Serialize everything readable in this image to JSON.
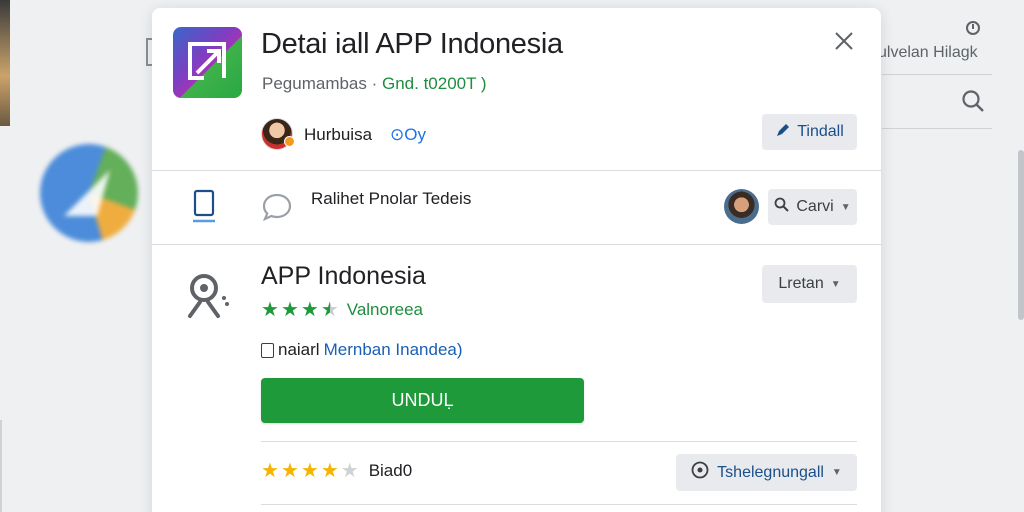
{
  "background": {
    "right_label": "ulvelan Hilagk"
  },
  "dialog": {
    "title": "Detai iall APP Indonesia",
    "subtitle_prefix": "Pegumambas · ",
    "subtitle_status": "Gnd. t0200T )",
    "developer": {
      "name": "Hurbuisa",
      "badge": "Oy"
    },
    "primary_action": "Tindall",
    "row2": {
      "text": "Ralihet Pnolar Tedeis",
      "search_button": "Carvi"
    },
    "app": {
      "name": "APP Indonesia",
      "rating_stars": 3.5,
      "rating_label": "Valnoreea",
      "filter_button": "Lretan",
      "checkbox_label": "naiarl",
      "link_text": "Mernban Inandea)",
      "install_label": "UNDUḶ"
    },
    "review": {
      "rating_stars": 4,
      "rating_label": "Biad0",
      "sort_button": "Tshelegnungall"
    }
  },
  "colors": {
    "accent_green": "#1e9a3b",
    "star_green": "#1e9a3b",
    "star_gold": "#f4b400",
    "link_blue": "#1a5fb4"
  }
}
